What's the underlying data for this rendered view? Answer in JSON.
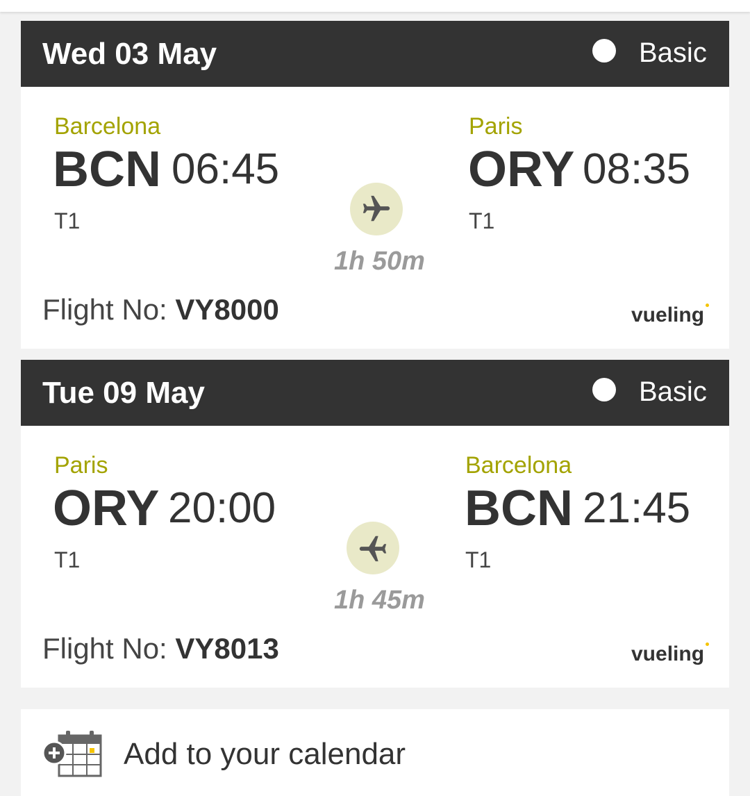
{
  "flights": [
    {
      "date": "Wed 03 May",
      "fare": "Basic",
      "origin": {
        "city": "Barcelona",
        "code": "BCN",
        "time": "06:45",
        "terminal": "T1"
      },
      "destination": {
        "city": "Paris",
        "code": "ORY",
        "time": "08:35",
        "terminal": "T1"
      },
      "duration": "1h 50m",
      "flight_no_label": "Flight No:",
      "flight_no": "VY8000",
      "airline": "vueling"
    },
    {
      "date": "Tue 09 May",
      "fare": "Basic",
      "origin": {
        "city": "Paris",
        "code": "ORY",
        "time": "20:00",
        "terminal": "T1"
      },
      "destination": {
        "city": "Barcelona",
        "code": "BCN",
        "time": "21:45",
        "terminal": "T1"
      },
      "duration": "1h 45m",
      "flight_no_label": "Flight No:",
      "flight_no": "VY8013",
      "airline": "vueling"
    }
  ],
  "calendar": {
    "label": "Add to your calendar",
    "icon": "calendar-add-icon"
  },
  "icons": {
    "outbound": "plane-right-icon",
    "inbound": "plane-left-icon"
  },
  "colors": {
    "header_bg": "#333333",
    "city_accent": "#a3a300",
    "plane_circle": "#e9e9c8",
    "duration_text": "#9a9a9a",
    "logo_dot": "#f5c400"
  }
}
